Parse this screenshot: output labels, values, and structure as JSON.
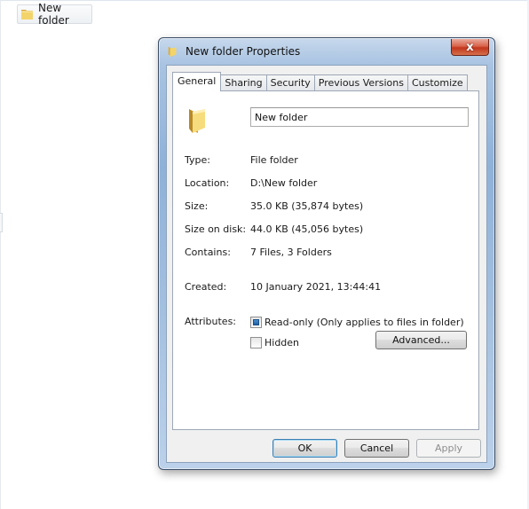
{
  "explorer": {
    "selected_item": {
      "label": "New folder",
      "icon": "folder-icon"
    }
  },
  "dialog": {
    "title": "New folder Properties",
    "icon": "folder-icon",
    "close_label": "x",
    "tabs": [
      {
        "label": "General",
        "active": true
      },
      {
        "label": "Sharing",
        "active": false
      },
      {
        "label": "Security",
        "active": false
      },
      {
        "label": "Previous Versions",
        "active": false
      },
      {
        "label": "Customize",
        "active": false
      }
    ],
    "general": {
      "name_value": "New folder",
      "type_label": "Type:",
      "type_value": "File folder",
      "location_label": "Location:",
      "location_value": "D:\\New folder",
      "size_label": "Size:",
      "size_value": "35.0 KB (35,874 bytes)",
      "size_on_disk_label": "Size on disk:",
      "size_on_disk_value": "44.0 KB (45,056 bytes)",
      "contains_label": "Contains:",
      "contains_value": "7 Files, 3 Folders",
      "created_label": "Created:",
      "created_value": "10 January 2021, 13:44:41",
      "attributes_label": "Attributes:",
      "readonly_label": "Read-only (Only applies to files in folder)",
      "readonly_state": "indeterminate",
      "hidden_label": "Hidden",
      "hidden_state": "unchecked",
      "advanced_label": "Advanced..."
    },
    "buttons": {
      "ok": "OK",
      "cancel": "Cancel",
      "apply": "Apply"
    }
  },
  "colors": {
    "folder_yellow": "#f3d46a",
    "folder_dark": "#d9a93a",
    "checkbox_blue": "#2f74bd",
    "close_red": "#c9462b"
  }
}
